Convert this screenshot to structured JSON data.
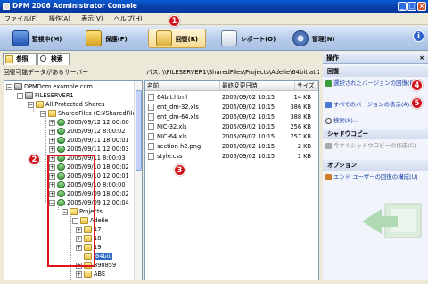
{
  "window": {
    "title": "DPM 2006 Administrator Console",
    "minimize": "_",
    "maximize": "□",
    "close": "×"
  },
  "menu": [
    "ファイル(F)",
    "操作(A)",
    "表示(V)",
    "ヘルプ(H)"
  ],
  "nav_tabs": [
    {
      "label": "監視中(M)",
      "icon": "monitor-icon"
    },
    {
      "label": "保護(P)",
      "icon": "lock-icon"
    },
    {
      "label": "回復(R)",
      "icon": "recovery-icon",
      "active": true
    },
    {
      "label": "レポート(O)",
      "icon": "report-icon"
    },
    {
      "label": "管理(N)",
      "icon": "gear-icon"
    }
  ],
  "info_label": "i",
  "callouts": [
    "1",
    "2",
    "3",
    "4",
    "5"
  ],
  "sub_tabs": [
    "参照",
    "検索"
  ],
  "left_panel_header": "回復可能データがあるサーバー",
  "path_bar": "パス:  \\\\FILESERVER1\\SharedFiles\\Projects\\Adelie\\64bit at 200...",
  "tree": {
    "root": "DPMDom.example.com",
    "server": "FILESERVER1",
    "protected": "All Protected Shares",
    "share": "SharedFiles (C:¥SharedFiles)",
    "snapshots": [
      "2005/09/12 12:00:00",
      "2005/09/12 8:00:02",
      "2005/09/11 18:00:01",
      "2005/09/11 12:00:03",
      "2005/09/11 8:00:03",
      "2005/09/10 18:00:02",
      "2005/09/10 12:00:01",
      "2005/09/10 8:00:00",
      "2005/09/09 18:00:02",
      "2005/09/09 12:00:04"
    ],
    "projects": "Projects",
    "adelie": "Adelie",
    "adelie_children": [
      "17",
      "18",
      "19",
      "64bit",
      "890859",
      "ABE"
    ]
  },
  "file_list": {
    "columns": [
      "名前",
      "最終変更日時",
      "サイズ"
    ],
    "rows": [
      {
        "name": "64bit.html",
        "modified": "2005/09/02 10:15",
        "size": "14 KB"
      },
      {
        "name": "ent_dm-32.xls",
        "modified": "2005/09/02 10:15",
        "size": "386 KB"
      },
      {
        "name": "ent_dm-64.xls",
        "modified": "2005/09/02 10:15",
        "size": "388 KB"
      },
      {
        "name": "NIC-32.xls",
        "modified": "2005/09/02 10:15",
        "size": "256 KB"
      },
      {
        "name": "NIC-64.xls",
        "modified": "2005/09/02 10:15",
        "size": "257 KB"
      },
      {
        "name": "section-h2.png",
        "modified": "2005/09/02 10:15",
        "size": "2 KB"
      },
      {
        "name": "style.css",
        "modified": "2005/09/02 10:15",
        "size": "1 KB"
      }
    ]
  },
  "actions": {
    "header": "操作",
    "close": "×",
    "sections": [
      {
        "title": "回復",
        "items": [
          {
            "label": "選択されたバージョンの回復(R)...",
            "enabled": true
          },
          {
            "label": "すべてのバージョンの表示(A)...",
            "enabled": true
          },
          {
            "label": "検索(S)...",
            "enabled": true
          }
        ]
      },
      {
        "title": "シャドウコピー",
        "items": [
          {
            "label": "今すぐシャドウコピーの作成(C)",
            "enabled": false
          }
        ]
      },
      {
        "title": "オプション",
        "items": [
          {
            "label": "エンド ユーザーの回復の構成(U)",
            "enabled": true
          }
        ]
      }
    ]
  },
  "colors": {
    "titlebar": "#0a4cc2",
    "callout": "#d0101a",
    "link": "#1a3fa8",
    "selection": "#316ac5"
  }
}
